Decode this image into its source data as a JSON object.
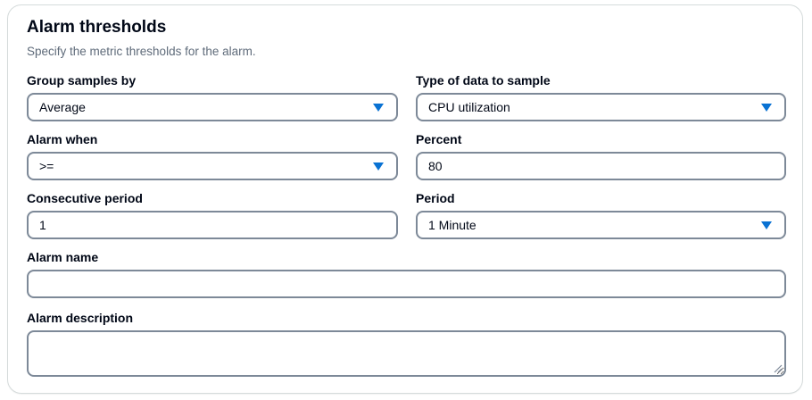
{
  "section": {
    "title": "Alarm thresholds",
    "description": "Specify the metric thresholds for the alarm."
  },
  "fields": {
    "group_samples_by": {
      "label": "Group samples by",
      "value": "Average"
    },
    "type_of_data": {
      "label": "Type of data to sample",
      "value": "CPU utilization"
    },
    "alarm_when": {
      "label": "Alarm when",
      "value": ">="
    },
    "percent": {
      "label": "Percent",
      "value": "80"
    },
    "consecutive_period": {
      "label": "Consecutive period",
      "value": "1"
    },
    "period": {
      "label": "Period",
      "value": "1 Minute"
    },
    "alarm_name": {
      "label": "Alarm name",
      "value": ""
    },
    "alarm_description": {
      "label": "Alarm description",
      "value": ""
    }
  },
  "icons": {
    "dropdown": "chevron-down-icon",
    "resize": "resize-handle-icon"
  },
  "colors": {
    "accent": "#0972d3",
    "border": "#7d8998",
    "text": "#000716",
    "muted": "#5f6b7a"
  }
}
